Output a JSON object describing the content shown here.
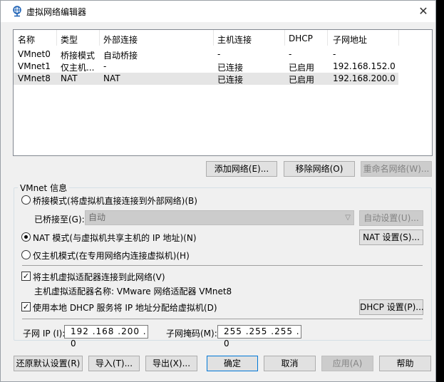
{
  "window": {
    "title": "虚拟网络编辑器",
    "close_glyph": "✕"
  },
  "list": {
    "headers": [
      "名称",
      "类型",
      "外部连接",
      "主机连接",
      "DHCP",
      "子网地址"
    ],
    "rows": [
      [
        "VMnet0",
        "桥接模式",
        "自动桥接",
        "-",
        "-",
        "-"
      ],
      [
        "VMnet1",
        "仅主机...",
        "-",
        "已连接",
        "已启用",
        "192.168.152.0"
      ],
      [
        "VMnet8",
        "NAT",
        "NAT",
        "已连接",
        "已启用",
        "192.168.200.0"
      ]
    ],
    "selected_index": 2
  },
  "list_buttons": {
    "add": "添加网络(E)...",
    "remove": "移除网络(O)",
    "rename": "重命名网络(W)..."
  },
  "vmnet_info": {
    "group_title": "VMnet 信息",
    "bridge_radio": "桥接模式(将虚拟机直接连接到外部网络)(B)",
    "bridged_to_label": "已桥接至(G):",
    "bridged_to_value": "自动",
    "auto_settings": "自动设置(U)...",
    "nat_radio": "NAT 模式(与虚拟机共享主机的 IP 地址)(N)",
    "nat_settings": "NAT 设置(S)...",
    "host_only_radio": "仅主机模式(在专用网络内连接虚拟机)(H)",
    "connect_adapter_check": "将主机虚拟适配器连接到此网络(V)",
    "adapter_name_label": "主机虚拟适配器名称: VMware 网络适配器 VMnet8",
    "dhcp_check": "使用本地 DHCP 服务将 IP 地址分配给虚拟机(D)",
    "dhcp_settings": "DHCP 设置(P)...",
    "subnet_ip_label": "子网 IP (I):",
    "subnet_ip_value": "192 .168 .200 . 0",
    "subnet_mask_label": "子网掩码(M):",
    "subnet_mask_value": "255 .255 .255 . 0"
  },
  "footer": {
    "restore": "还原默认设置(R)",
    "import": "导入(T)...",
    "export": "导出(X)...",
    "ok": "确定",
    "cancel": "取消",
    "apply": "应用(A)",
    "help": "帮助"
  }
}
